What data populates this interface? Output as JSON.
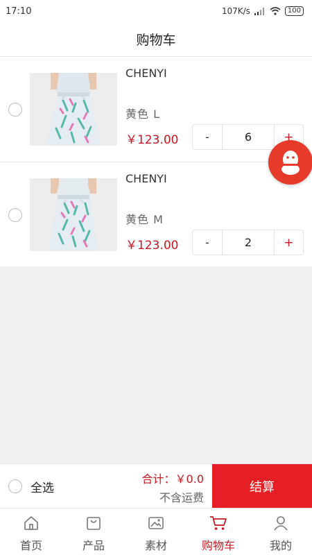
{
  "status_bar": {
    "time": "17:10",
    "network_speed": "107K/s",
    "battery": "100"
  },
  "header": {
    "title": "购物车"
  },
  "cart": {
    "items": [
      {
        "brand": "CHENYI",
        "spec": "黄色  L",
        "price": "￥123.00",
        "minus": "-",
        "quantity": "6",
        "plus": "+"
      },
      {
        "brand": "CHENYI",
        "spec": "黄色  M",
        "price": "￥123.00",
        "minus": "-",
        "quantity": "2",
        "plus": "+"
      }
    ]
  },
  "summary": {
    "select_all": "全选",
    "total": "合计：￥0.0",
    "shipping_note": "不含运费",
    "checkout": "结算"
  },
  "tabbar": {
    "tabs": [
      {
        "label": "首页",
        "icon": "home-icon"
      },
      {
        "label": "产品",
        "icon": "bag-icon"
      },
      {
        "label": "素材",
        "icon": "image-icon"
      },
      {
        "label": "购物车",
        "icon": "cart-icon",
        "active": true
      },
      {
        "label": "我的",
        "icon": "user-icon"
      }
    ]
  },
  "colors": {
    "accent": "#e61e25",
    "price": "#c8161e",
    "qq_button": "#e63a2a"
  }
}
